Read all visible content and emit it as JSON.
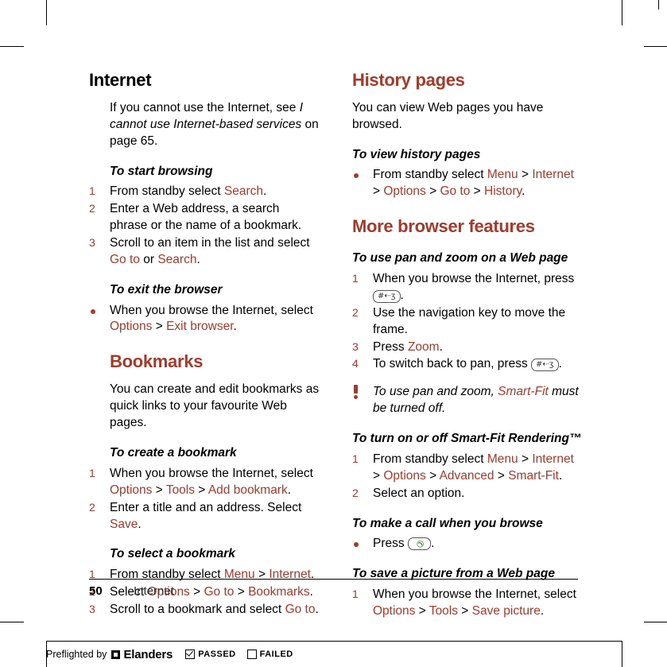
{
  "document": {
    "footer": {
      "page_number": "50",
      "chapter": "Internet"
    },
    "preflight": {
      "label": "Preflighted by",
      "logo": "Elanders",
      "passed": "PASSED",
      "failed": "FAILED"
    }
  },
  "left_column": {
    "heading": "Internet",
    "intro": "If you cannot use the Internet, see I cannot use Internet-based services on page 65.",
    "sections": [
      {
        "title": "To start browsing",
        "type": "ordered",
        "items": [
          "From standby select Search.",
          "Enter a Web address, a search phrase or the name of a bookmark.",
          "Scroll to an item in the list and select Go to or Search."
        ]
      },
      {
        "title": "To exit the browser",
        "type": "bulleted",
        "items": [
          "When you browse the Internet, select Options > Exit browser."
        ]
      }
    ],
    "bookmarks": {
      "heading": "Bookmarks",
      "intro": "You can create and edit bookmarks as quick links to your favourite Web pages.",
      "sections": [
        {
          "title": "To create a bookmark",
          "type": "ordered",
          "items": [
            "When you browse the Internet, select Options > Tools > Add bookmark.",
            "Enter a title and an address. Select Save."
          ]
        },
        {
          "title": "To select a bookmark",
          "type": "ordered",
          "items": [
            "From standby select Menu > Internet.",
            "Select Options > Go to > Bookmarks.",
            "Scroll to a bookmark and select Go to."
          ]
        }
      ]
    }
  },
  "right_column": {
    "history": {
      "heading": "History pages",
      "intro": "You can view Web pages you have browsed.",
      "sections": [
        {
          "title": "To view history pages",
          "type": "bulleted",
          "items": [
            "From standby select Menu > Internet > Options > Go to > History."
          ]
        }
      ]
    },
    "more_features": {
      "heading": "More browser features",
      "sections": [
        {
          "title": "To use pan and zoom on a Web page",
          "type": "ordered",
          "items": [
            "When you browse the Internet, press [hash-key].",
            "Use the navigation key to move the frame.",
            "Press Zoom.",
            "To switch back to pan, press [hash-key]."
          ]
        }
      ],
      "note": "To use pan and zoom, Smart-Fit must be turned off.",
      "smartfit": {
        "title": "To turn on or off Smart-Fit Rendering™",
        "type": "ordered",
        "items": [
          "From standby select Menu > Internet > Options > Advanced > Smart-Fit.",
          "Select an option."
        ]
      },
      "call": {
        "title": "To make a call when you browse",
        "type": "bulleted",
        "items": [
          "Press [call-key]."
        ]
      },
      "save_picture": {
        "title": "To save a picture from a Web page",
        "type": "ordered",
        "items": [
          "When you browse the Internet, select Options > Tools > Save picture."
        ]
      }
    }
  },
  "keys": {
    "hash_key": "#←ʒ",
    "call_key": "✆"
  }
}
